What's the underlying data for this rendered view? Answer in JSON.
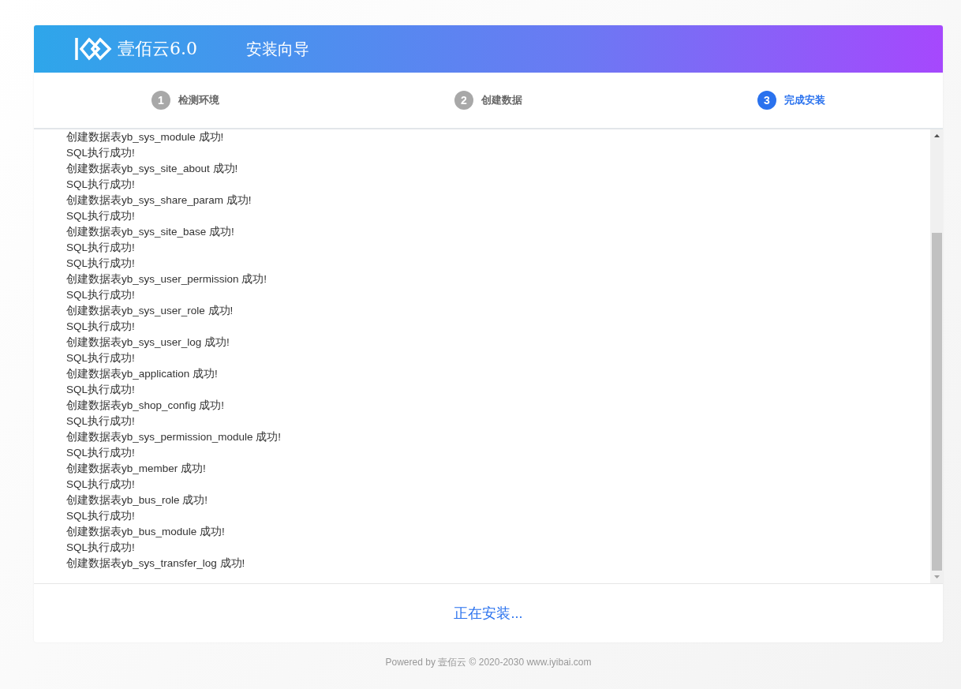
{
  "header": {
    "brand": "壹佰云6.0",
    "title": "安装向导"
  },
  "steps": [
    {
      "number": "1",
      "label": "检测环境",
      "selected": false
    },
    {
      "number": "2",
      "label": "创建数据",
      "selected": false
    },
    {
      "number": "3",
      "label": "完成安装",
      "selected": true
    }
  ],
  "log": [
    "创建数据表yb_sys_module 成功!",
    "SQL执行成功!",
    "创建数据表yb_sys_site_about 成功!",
    "SQL执行成功!",
    "创建数据表yb_sys_share_param 成功!",
    "SQL执行成功!",
    "创建数据表yb_sys_site_base 成功!",
    "SQL执行成功!",
    "SQL执行成功!",
    "创建数据表yb_sys_user_permission 成功!",
    "SQL执行成功!",
    "创建数据表yb_sys_user_role 成功!",
    "SQL执行成功!",
    "创建数据表yb_sys_user_log 成功!",
    "SQL执行成功!",
    "创建数据表yb_application 成功!",
    "SQL执行成功!",
    "创建数据表yb_shop_config 成功!",
    "SQL执行成功!",
    "创建数据表yb_sys_permission_module 成功!",
    "SQL执行成功!",
    "创建数据表yb_member 成功!",
    "SQL执行成功!",
    "创建数据表yb_bus_role 成功!",
    "SQL执行成功!",
    "创建数据表yb_bus_module 成功!",
    "SQL执行成功!",
    "创建数据表yb_sys_transfer_log 成功!"
  ],
  "status": "正在安装...",
  "footer": "Powered by 壹佰云 © 2020-2030 www.iyibai.com"
}
